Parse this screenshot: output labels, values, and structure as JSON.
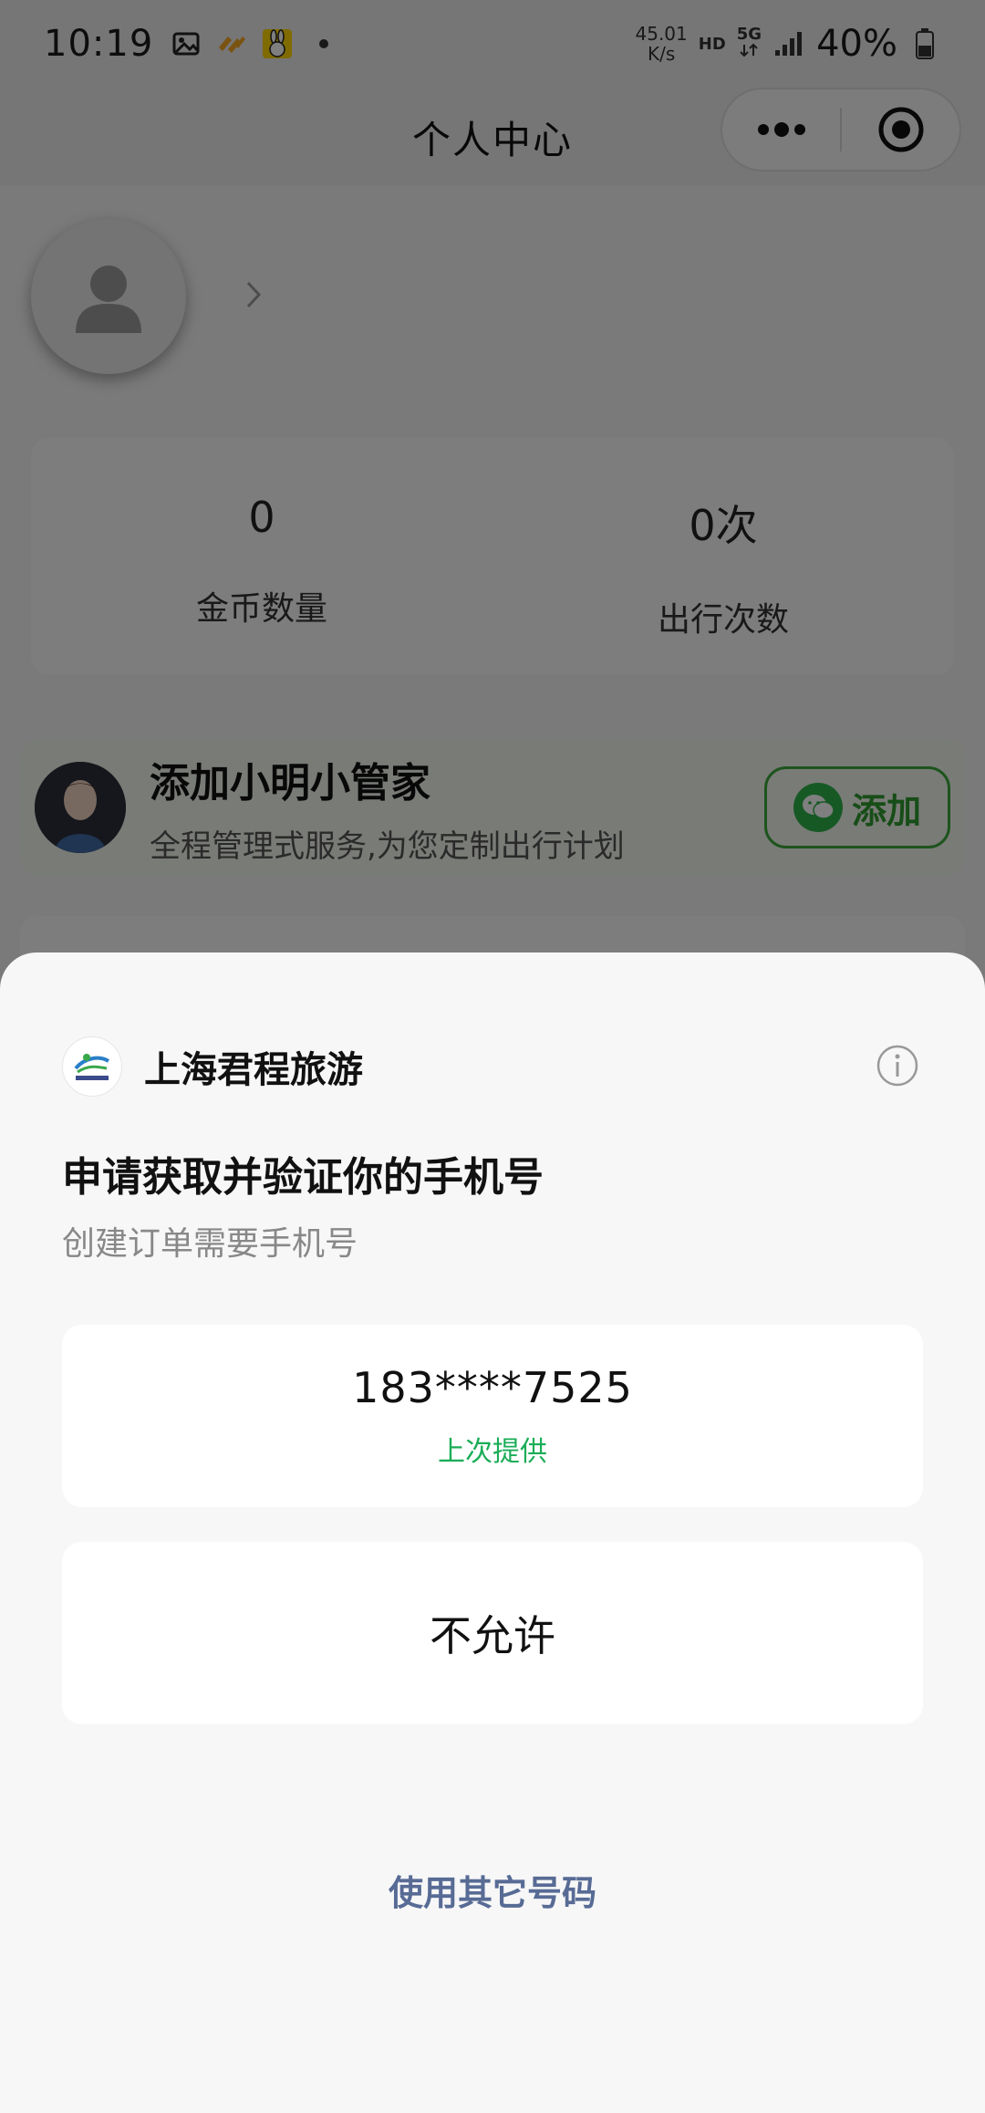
{
  "status_bar": {
    "time": "10:19",
    "speed_value": "45.01",
    "speed_unit": "K/s",
    "hd": "HD",
    "network": "5G",
    "battery": "40%"
  },
  "nav": {
    "title": "个人中心"
  },
  "stats": [
    {
      "value": "0",
      "label": "金币数量"
    },
    {
      "value": "0次",
      "label": "出行次数"
    }
  ],
  "butler": {
    "title": "添加小明小管家",
    "subtitle": "全程管理式服务,为您定制出行计划",
    "button_label": "添加"
  },
  "sheet": {
    "app_name": "上海君程旅游",
    "title": "申请获取并验证你的手机号",
    "description": "创建订单需要手机号",
    "phone_option": {
      "number": "183****7525",
      "tag": "上次提供"
    },
    "deny_label": "不允许",
    "other_number_label": "使用其它号码"
  },
  "colors": {
    "accent_green": "#1aad57",
    "link_blue": "#576b95",
    "wechat_green": "#2fb34a"
  }
}
